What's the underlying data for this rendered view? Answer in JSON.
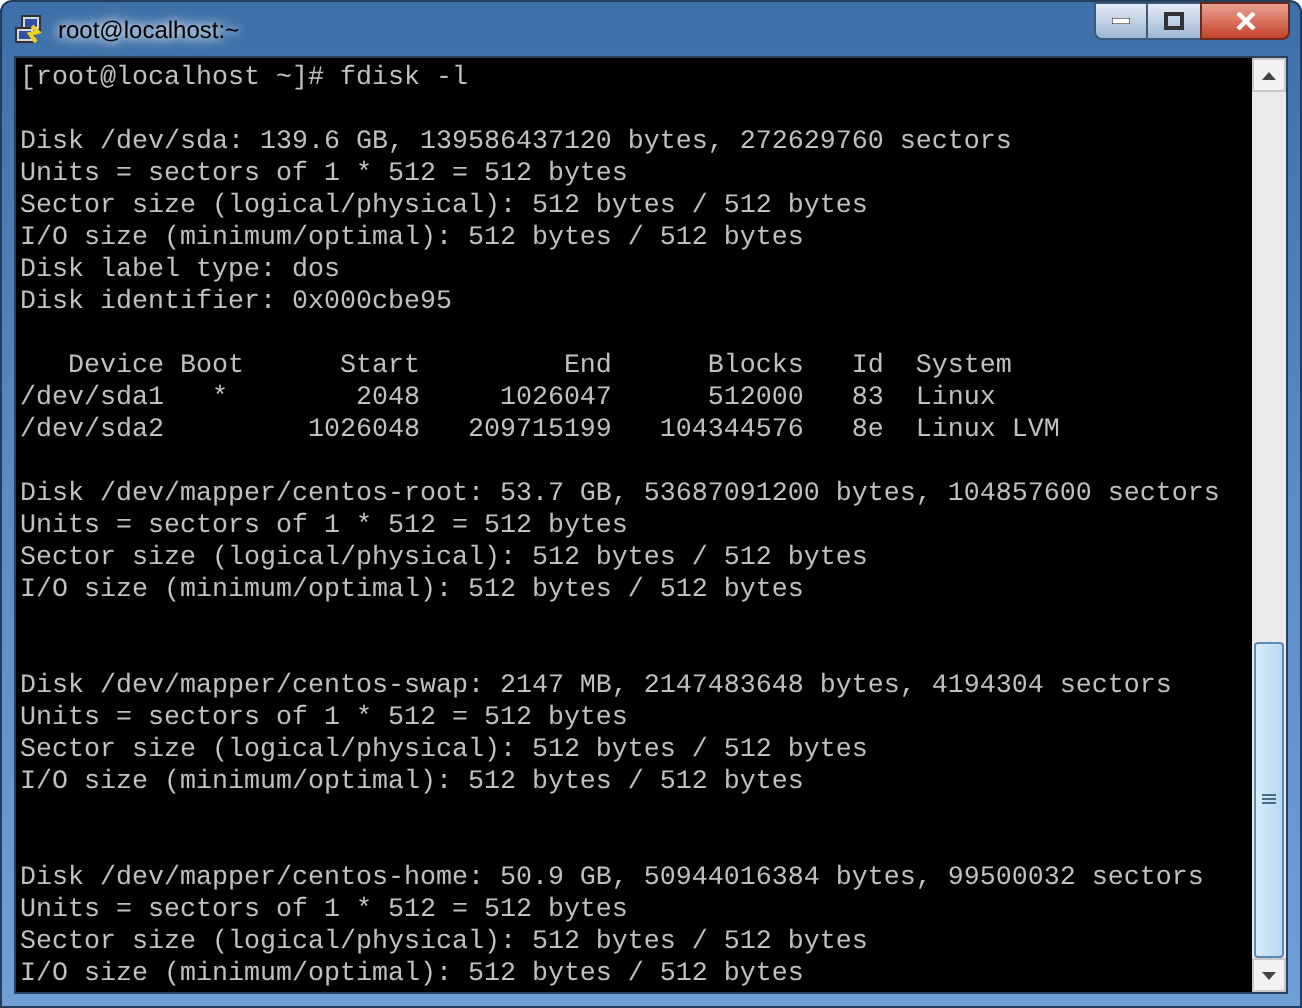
{
  "window": {
    "title": "root@localhost:~"
  },
  "terminal": {
    "lines": [
      {
        "kind": "text",
        "text": "[root@localhost ~]# fdisk -l"
      },
      {
        "kind": "blank"
      },
      {
        "kind": "text",
        "text": "Disk /dev/sda: 139.6 GB, 139586437120 bytes, 272629760 sectors"
      },
      {
        "kind": "text",
        "text": "Units = sectors of 1 * 512 = 512 bytes"
      },
      {
        "kind": "text",
        "text": "Sector size (logical/physical): 512 bytes / 512 bytes"
      },
      {
        "kind": "text",
        "text": "I/O size (minimum/optimal): 512 bytes / 512 bytes"
      },
      {
        "kind": "text",
        "text": "Disk label type: dos"
      },
      {
        "kind": "text",
        "text": "Disk identifier: 0x000cbe95"
      },
      {
        "kind": "blank"
      },
      {
        "kind": "text",
        "text": "   Device Boot      Start         End      Blocks   Id  System"
      },
      {
        "kind": "text",
        "text": "/dev/sda1   *        2048     1026047      512000   83  Linux"
      },
      {
        "kind": "text",
        "text": "/dev/sda2         1026048   209715199   104344576   8e  Linux LVM"
      },
      {
        "kind": "blank"
      },
      {
        "kind": "text",
        "text": "Disk /dev/mapper/centos-root: 53.7 GB, 53687091200 bytes, 104857600 sectors"
      },
      {
        "kind": "text",
        "text": "Units = sectors of 1 * 512 = 512 bytes"
      },
      {
        "kind": "text",
        "text": "Sector size (logical/physical): 512 bytes / 512 bytes"
      },
      {
        "kind": "text",
        "text": "I/O size (minimum/optimal): 512 bytes / 512 bytes"
      },
      {
        "kind": "blank"
      },
      {
        "kind": "blank"
      },
      {
        "kind": "text",
        "text": "Disk /dev/mapper/centos-swap: 2147 MB, 2147483648 bytes, 4194304 sectors"
      },
      {
        "kind": "text",
        "text": "Units = sectors of 1 * 512 = 512 bytes"
      },
      {
        "kind": "text",
        "text": "Sector size (logical/physical): 512 bytes / 512 bytes"
      },
      {
        "kind": "text",
        "text": "I/O size (minimum/optimal): 512 bytes / 512 bytes"
      },
      {
        "kind": "blank"
      },
      {
        "kind": "blank"
      },
      {
        "kind": "text",
        "text": "Disk /dev/mapper/centos-home: 50.9 GB, 50944016384 bytes, 99500032 sectors"
      },
      {
        "kind": "text",
        "text": "Units = sectors of 1 * 512 = 512 bytes"
      },
      {
        "kind": "text",
        "text": "Sector size (logical/physical): 512 bytes / 512 bytes"
      },
      {
        "kind": "text",
        "text": "I/O size (minimum/optimal): 512 bytes / 512 bytes"
      }
    ]
  }
}
